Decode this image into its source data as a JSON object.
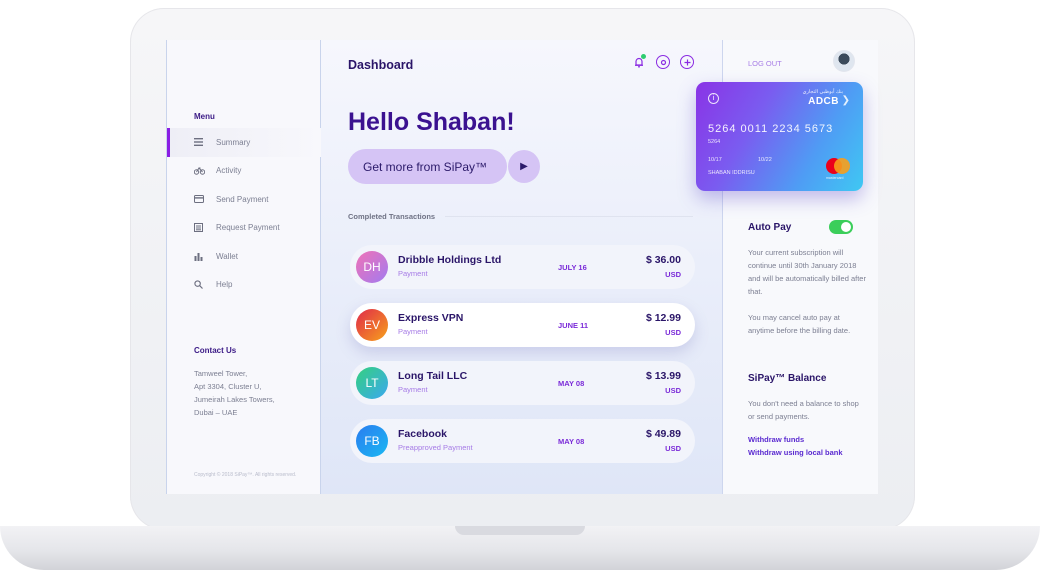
{
  "app": {
    "title": "Dashboard"
  },
  "sidebar": {
    "menu_title": "Menu",
    "items": [
      {
        "label": "Summary",
        "icon": "list-icon",
        "active": true
      },
      {
        "label": "Activity",
        "icon": "bicycle-icon",
        "active": false
      },
      {
        "label": "Send Payment",
        "icon": "card-icon",
        "active": false
      },
      {
        "label": "Request Payment",
        "icon": "document-icon",
        "active": false
      },
      {
        "label": "Wallet",
        "icon": "bar-chart-icon",
        "active": false
      },
      {
        "label": "Help",
        "icon": "search-icon",
        "active": false
      }
    ],
    "contact_title": "Contact Us",
    "address_lines": [
      "Tamweel Tower,",
      "Apt 3304, Cluster U,",
      "Jumeirah Lakes Towers,",
      "Dubai – UAE"
    ],
    "copyright": "Copyright © 2018 SiPay™. All rights reserved."
  },
  "main": {
    "greeting": "Hello Shaban!",
    "cta_label": "Get more from SiPay™",
    "section_label": "Completed Transactions",
    "transactions": [
      {
        "initials": "DH",
        "name": "Dribble Holdings Ltd",
        "type": "Payment",
        "date": "JULY 16",
        "amount": "$ 36.00",
        "currency": "USD",
        "color_from": "#f072b6",
        "color_to": "#a27bf0"
      },
      {
        "initials": "EV",
        "name": "Express VPN",
        "type": "Payment",
        "date": "JUNE 11",
        "amount": "$ 12.99",
        "currency": "USD",
        "color_from": "#e0294a",
        "color_to": "#f7a21b"
      },
      {
        "initials": "LT",
        "name": "Long Tail LLC",
        "type": "Payment",
        "date": "MAY 08",
        "amount": "$ 13.99",
        "currency": "USD",
        "color_from": "#35d07f",
        "color_to": "#3aa8f0"
      },
      {
        "initials": "FB",
        "name": "Facebook",
        "type": "Preapproved Payment",
        "date": "MAY 08",
        "amount": "$ 49.89",
        "currency": "USD",
        "color_from": "#2a7cf0",
        "color_to": "#1ab8f2"
      }
    ]
  },
  "right": {
    "logout": "LOG OUT",
    "card": {
      "bank_arabic": "بنك أبوظبي التجاري",
      "bank": "ADCB",
      "number": "5264 0011 2234 5673",
      "number_small": "5264",
      "date_from": "10/17",
      "date_to": "10/22",
      "holder": "SHABAN IDDRISU",
      "network_text": "mastercard"
    },
    "autopay_title": "Auto Pay",
    "autopay_on": true,
    "autopay_note": "Your current subscription will continue until 30th January 2018 and will be automatically billed after that.",
    "autopay_cancel": "You may cancel auto pay at anytime before the billing date.",
    "balance_title": "SiPay™ Balance",
    "balance_note": "You don't need a balance to shop or send payments.",
    "link_withdraw": "Withdraw funds",
    "link_withdraw_bank": "Withdraw using local bank"
  },
  "colors": {
    "accent": "#8a1ee4",
    "title": "#2a1568",
    "toggle": "#3bce5a"
  }
}
